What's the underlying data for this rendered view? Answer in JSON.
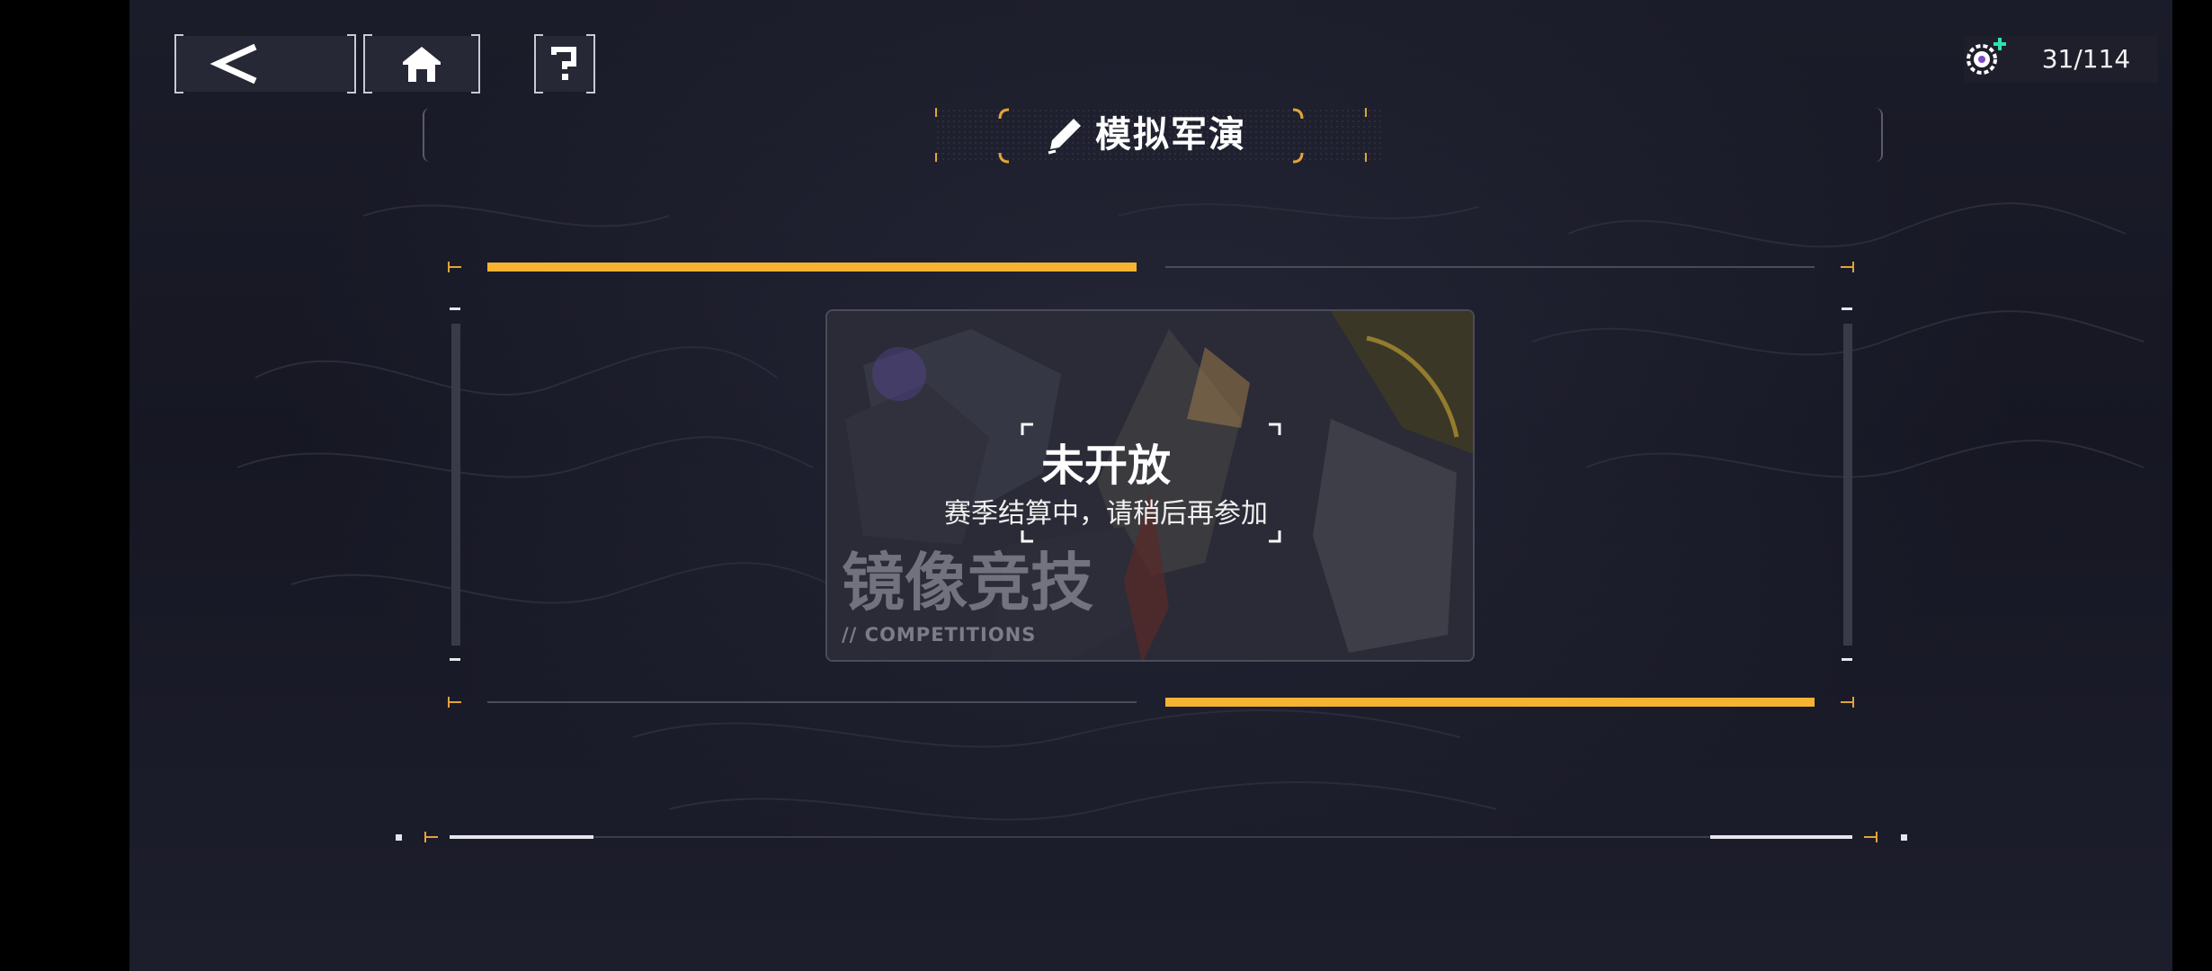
{
  "header": {
    "title": "模拟军演",
    "resource_value": "31/114"
  },
  "card": {
    "status_title": "未开放",
    "status_message": "赛季结算中，请稍后再参加",
    "mode_name": "镜像竞技",
    "mode_subtitle": "// COMPETITIONS"
  },
  "icons": {
    "back": "back-arrow-icon",
    "home": "home-icon",
    "help": "question-mark-icon",
    "title": "pen-icon",
    "resource": "gear-token-icon"
  },
  "colors": {
    "accent": "#f5b331",
    "background": "#1a1b27",
    "resource_plus": "#2ee3b0"
  }
}
